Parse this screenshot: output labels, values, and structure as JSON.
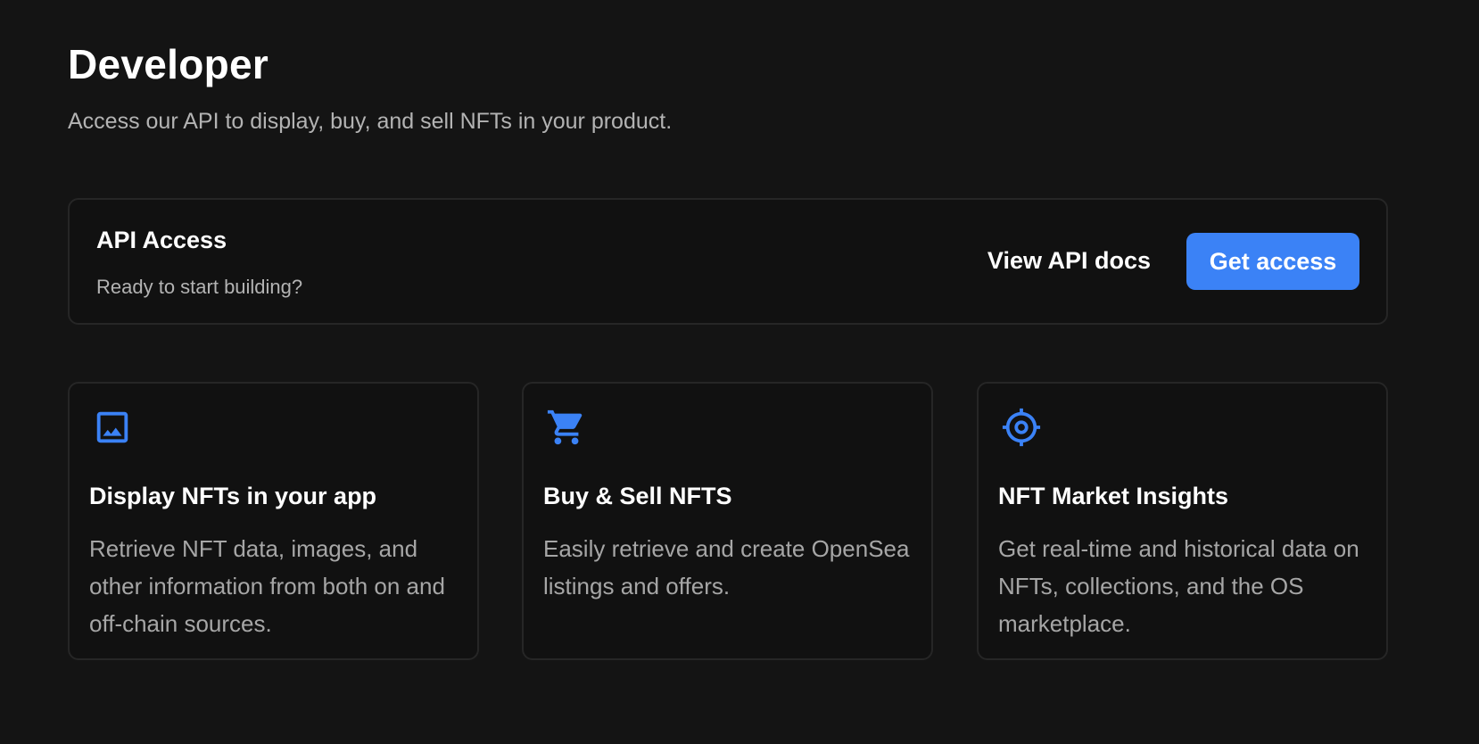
{
  "header": {
    "title": "Developer",
    "subtitle": "Access our API to display, buy, and sell NFTs in your product."
  },
  "api_access": {
    "title": "API Access",
    "description": "Ready to start building?",
    "docs_label": "View API docs",
    "access_label": "Get access"
  },
  "features": [
    {
      "icon": "image-icon",
      "title": "Display NFTs in your app",
      "description": "Retrieve NFT data, images, and other information from both on and off-chain sources."
    },
    {
      "icon": "shopping-cart-icon",
      "title": "Buy & Sell NFTS",
      "description": "Easily retrieve and create OpenSea listings and offers."
    },
    {
      "icon": "target-icon",
      "title": "NFT Market Insights",
      "description": "Get real-time and historical data on NFTs, collections, and the OS marketplace."
    }
  ],
  "colors": {
    "background": "#141414",
    "card_background": "#111111",
    "card_border": "#262626",
    "accent": "#3b82f6",
    "icon": "#3b82f6",
    "text_primary": "#ffffff",
    "text_secondary": "#b3b3b3"
  }
}
